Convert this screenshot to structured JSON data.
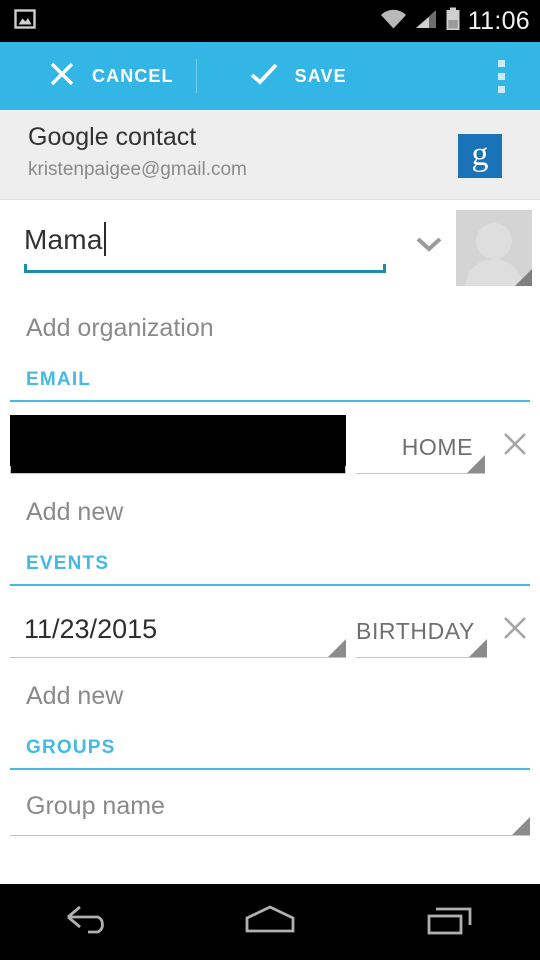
{
  "status_bar": {
    "notification_icon": "image-icon",
    "wifi_icon": "wifi-icon",
    "signal_icon": "signal-bars-icon",
    "battery_icon": "battery-icon",
    "time": "11:06"
  },
  "action_bar": {
    "background_color": "#33b5e5",
    "cancel_label": "CANCEL",
    "cancel_icon": "close-icon",
    "save_label": "SAVE",
    "save_icon": "check-icon",
    "overflow_icon": "overflow-menu-icon"
  },
  "account": {
    "title": "Google contact",
    "email": "kristenpaigee@gmail.com",
    "badge_letter": "g",
    "badge_color": "#1a73b7"
  },
  "name_field": {
    "value": "Mama",
    "expand_icon": "chevron-down-icon",
    "underline_color": "#1a8fa8",
    "avatar_icon": "contact-avatar-placeholder"
  },
  "organization": {
    "placeholder": "Add organization"
  },
  "sections": [
    {
      "label": "EMAIL",
      "color": "#43b9e3",
      "rows": [
        {
          "value": "",
          "redacted": true,
          "type_label": "HOME",
          "delete_icon": "close-icon"
        }
      ],
      "add_new_label": "Add new"
    },
    {
      "label": "EVENTS",
      "color": "#43b9e3",
      "rows": [
        {
          "value": "11/23/2015",
          "redacted": false,
          "type_label": "BIRTHDAY",
          "delete_icon": "close-icon"
        }
      ],
      "add_new_label": "Add new"
    },
    {
      "label": "GROUPS",
      "color": "#43b9e3",
      "group_placeholder": "Group name"
    }
  ],
  "nav_bar": {
    "back_icon": "back-arrow-icon",
    "home_icon": "home-icon",
    "recents_icon": "recent-apps-icon"
  }
}
